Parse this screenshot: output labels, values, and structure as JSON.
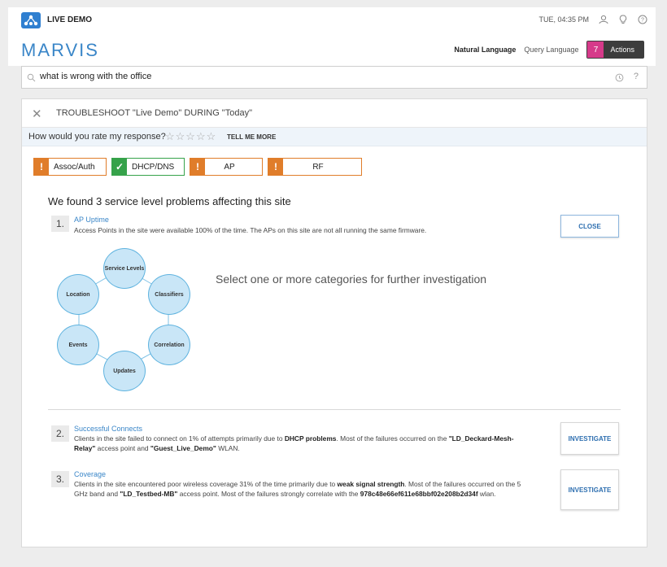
{
  "topbar": {
    "site_name": "LIVE DEMO",
    "datetime": "TUE, 04:35 PM",
    "icons": [
      "user-icon",
      "lightbulb-icon",
      "help-icon"
    ]
  },
  "header": {
    "brand": "MARVIS",
    "mode_natural": "Natural Language",
    "mode_query": "Query Language",
    "actions_count": "7",
    "actions_label": "Actions",
    "actions_badge_color": "#d63a8a"
  },
  "search": {
    "value": "what is wrong with the office",
    "help": "?"
  },
  "panel": {
    "title": "TROUBLESHOOT \"Live Demo\" DURING \"Today\"",
    "rating_question": "How would you rate my response?",
    "stars": "☆☆☆☆☆",
    "tell_more": "TELL ME MORE",
    "categories": [
      {
        "label": "Assoc/Auth",
        "status": "warn"
      },
      {
        "label": "DHCP/DNS",
        "status": "ok"
      },
      {
        "label": "AP",
        "status": "warn"
      },
      {
        "label": "RF",
        "status": "warn"
      }
    ],
    "summary": "We found 3 service level problems affecting this site",
    "problems": [
      {
        "num": "1.",
        "title": "AP Uptime",
        "desc": "Access Points in the site were available 100% of the time. The APs on this site are not all running the same firmware.",
        "button": "CLOSE"
      },
      {
        "num": "2.",
        "title": "Successful Connects",
        "desc_parts": [
          "Clients in the site failed to connect on 1% of attempts primarily due to ",
          "DHCP problems",
          ". Most of the failures occurred on the ",
          "\"LD_Deckard-Mesh-Relay\"",
          " access point and ",
          "\"Guest_Live_Demo\"",
          " WLAN."
        ],
        "button": "INVESTIGATE"
      },
      {
        "num": "3.",
        "title": "Coverage",
        "desc_parts": [
          "Clients in the site encountered poor wireless coverage 31% of the time primarily due to ",
          "weak signal strength",
          ". Most of the failures occurred on the 5 GHz band and ",
          "\"LD_Testbed-MB\"",
          " access point. Most of the failures strongly correlate with the ",
          "978c48e66ef611e68bbf02e208b2d34f",
          " wlan."
        ],
        "button": "INVESTIGATE"
      }
    ],
    "wheel": [
      "Service Levels",
      "Classifiers",
      "Correlation",
      "Updates",
      "Events",
      "Location"
    ],
    "prompt": "Select one or more categories for further investigation"
  },
  "colors": {
    "accent": "#3a86c8",
    "warn": "#e07d2a",
    "ok": "#36a24a"
  }
}
